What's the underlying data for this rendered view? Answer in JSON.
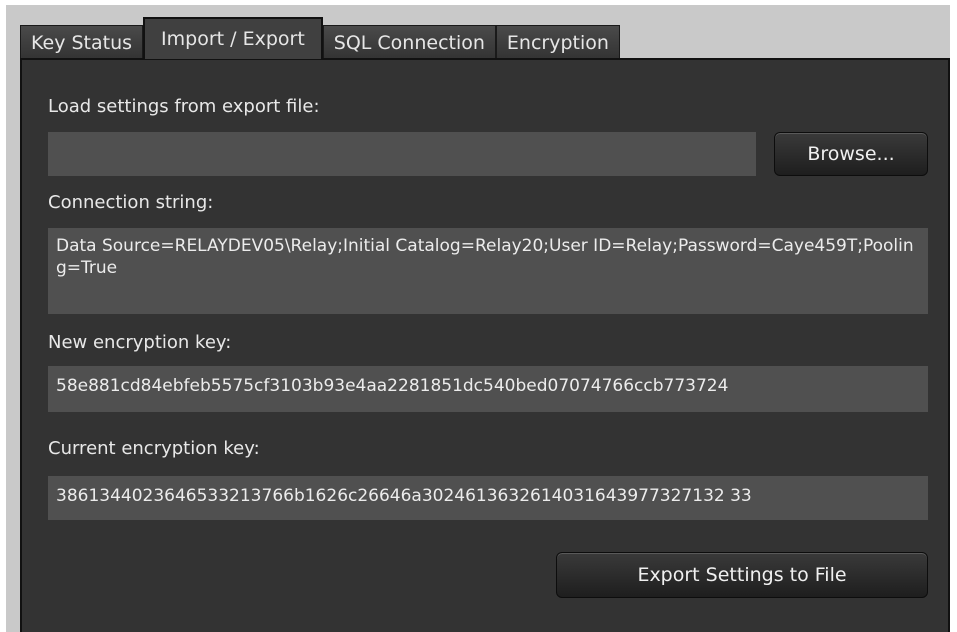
{
  "tabs": [
    {
      "label": "Key Status"
    },
    {
      "label": "Import / Export"
    },
    {
      "label": "SQL Connection"
    },
    {
      "label": "Encryption"
    }
  ],
  "active_tab": "Import / Export",
  "load": {
    "label": "Load settings from export file:",
    "value": "",
    "browse_label": "Browse..."
  },
  "connection": {
    "label": "Connection string:",
    "value": "Data Source=RELAYDEV05\\Relay;Initial Catalog=Relay20;User ID=Relay;Password=Caye459T;Pooling=True"
  },
  "new_key": {
    "label": "New encryption key:",
    "value": "58e881cd84ebfeb5575cf3103b93e4aa2281851dc540bed07074766ccb773724"
  },
  "current_key": {
    "label": "Current encryption key:",
    "value": "3861344023646533213766b1626c26646a3024613632614031643977327132 33"
  },
  "export_label": "Export Settings to File"
}
